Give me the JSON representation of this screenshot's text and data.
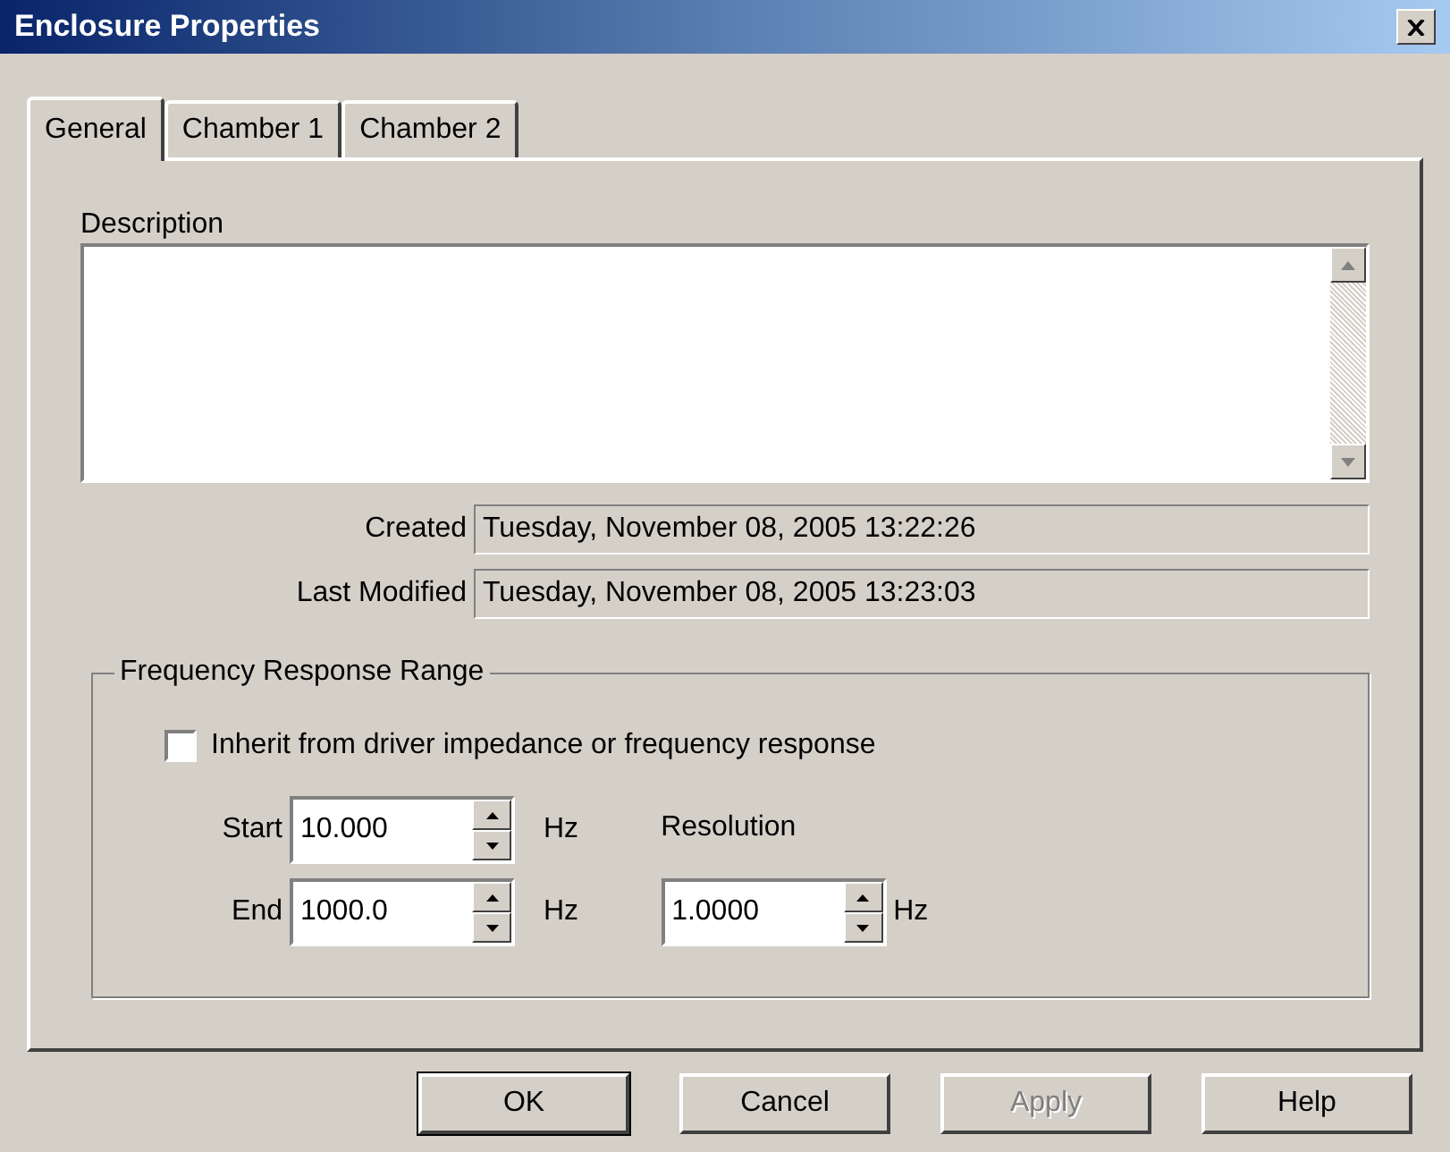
{
  "window": {
    "title": "Enclosure Properties"
  },
  "tabs": [
    {
      "label": "General",
      "selected": true
    },
    {
      "label": "Chamber 1",
      "selected": false
    },
    {
      "label": "Chamber 2",
      "selected": false
    }
  ],
  "description": {
    "label": "Description"
  },
  "info": [
    {
      "label": "Created",
      "value": "Tuesday, November 08, 2005 13:22:26"
    },
    {
      "label": "Last Modified",
      "value": "Tuesday, November 08, 2005 13:23:03"
    }
  ],
  "frequency_range": {
    "title": "Frequency Response Range",
    "inherit": {
      "label": "Inherit from driver impedance or frequency response",
      "checked": false
    },
    "start": {
      "label": "Start",
      "value": "10.000",
      "unit": "Hz"
    },
    "end": {
      "label": "End",
      "value": "1000.0",
      "unit": "Hz"
    },
    "resolution": {
      "label": "Resolution",
      "value": "1.0000",
      "unit": "Hz"
    }
  },
  "buttons": [
    {
      "label": "OK",
      "default": true,
      "disabled": false
    },
    {
      "label": "Cancel",
      "default": false,
      "disabled": false
    },
    {
      "label": "Apply",
      "default": false,
      "disabled": true
    },
    {
      "label": "Help",
      "default": false,
      "disabled": false
    }
  ]
}
